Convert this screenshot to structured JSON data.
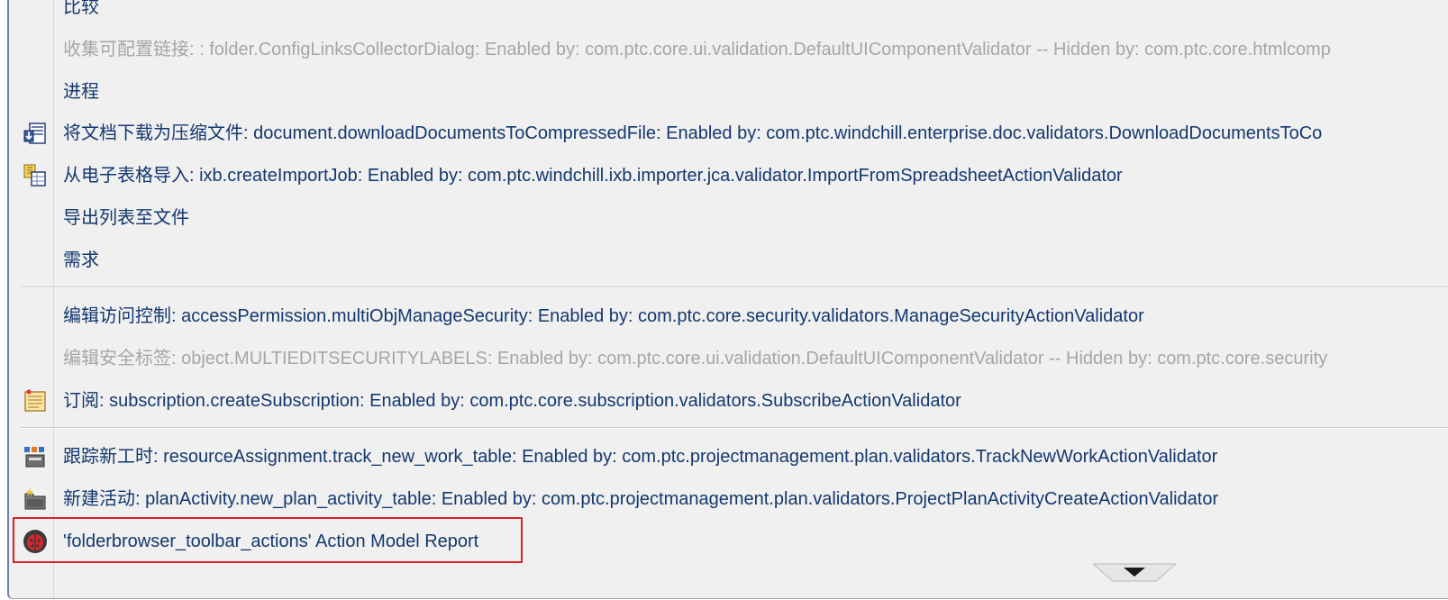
{
  "menu": {
    "items": [
      {
        "label": "比较",
        "enabled": true,
        "icon": ""
      },
      {
        "label": "收集可配置链接: : folder.ConfigLinksCollectorDialog: Enabled by: com.ptc.core.ui.validation.DefaultUIComponentValidator -- Hidden by: com.ptc.core.htmlcomp",
        "enabled": false,
        "icon": ""
      },
      {
        "label": "进程",
        "enabled": true,
        "icon": ""
      },
      {
        "label": "将文档下载为压缩文件: document.downloadDocumentsToCompressedFile: Enabled by: com.ptc.windchill.enterprise.doc.validators.DownloadDocumentsToCo",
        "enabled": true,
        "icon": "download-compressed-icon"
      },
      {
        "label": "从电子表格导入: ixb.createImportJob: Enabled by: com.ptc.windchill.ixb.importer.jca.validator.ImportFromSpreadsheetActionValidator",
        "enabled": true,
        "icon": "import-spreadsheet-icon"
      },
      {
        "label": "导出列表至文件",
        "enabled": true,
        "icon": ""
      },
      {
        "label": "需求",
        "enabled": true,
        "icon": ""
      },
      {
        "label": "编辑访问控制: accessPermission.multiObjManageSecurity: Enabled by: com.ptc.core.security.validators.ManageSecurityActionValidator",
        "enabled": true,
        "icon": ""
      },
      {
        "label": "编辑安全标签: object.MULTIEDITSECURITYLABELS: Enabled by: com.ptc.core.ui.validation.DefaultUIComponentValidator -- Hidden by: com.ptc.core.security",
        "enabled": false,
        "icon": ""
      },
      {
        "label": "订阅: subscription.createSubscription: Enabled by: com.ptc.core.subscription.validators.SubscribeActionValidator",
        "enabled": true,
        "icon": "subscription-icon"
      },
      {
        "label": "跟踪新工时: resourceAssignment.track_new_work_table: Enabled by: com.ptc.projectmanagement.plan.validators.TrackNewWorkActionValidator",
        "enabled": true,
        "icon": "track-work-icon"
      },
      {
        "label": "新建活动: planActivity.new_plan_activity_table: Enabled by: com.ptc.projectmanagement.plan.validators.ProjectPlanActivityCreateActionValidator",
        "enabled": true,
        "icon": "new-activity-icon"
      },
      {
        "label": "'folderbrowser_toolbar_actions' Action Model Report",
        "enabled": true,
        "icon": "bug-report-icon"
      }
    ]
  },
  "colors": {
    "enabled_text": "#13386e",
    "disabled_text": "#a6a6a6",
    "highlight_border": "#d9232c",
    "menu_background": "#f0f0f0"
  }
}
